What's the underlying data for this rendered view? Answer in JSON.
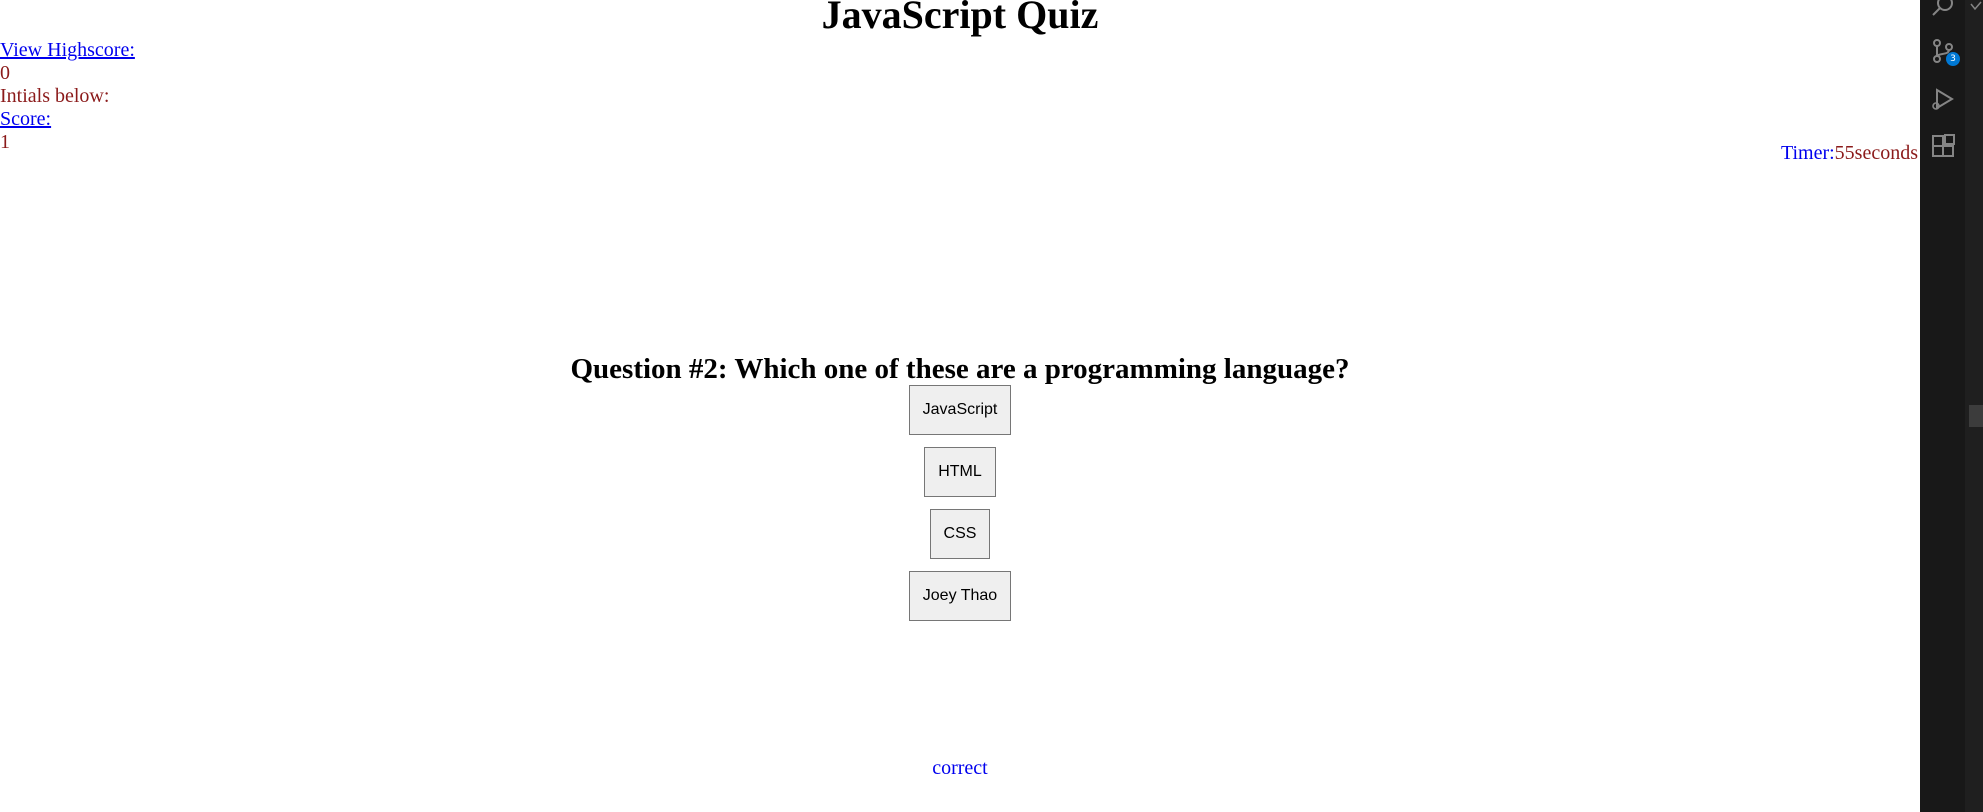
{
  "title": "JavaScript Quiz",
  "left_info": {
    "view_highscore": "View Highscore:",
    "highscore_value": "0",
    "initials_label": "Intials below:",
    "score_label": "Score:",
    "score_value": "1"
  },
  "timer": {
    "label": "Timer:",
    "value": "55seconds"
  },
  "question": "Question #2: Which one of these are a programming language?",
  "answers": [
    "JavaScript",
    "HTML",
    "CSS",
    "Joey Thao"
  ],
  "feedback": "correct",
  "sidebar": {
    "icons": [
      "search-icon",
      "source-control-icon",
      "run-debug-icon",
      "extensions-icon"
    ],
    "source_control_badge": "3"
  },
  "colors": {
    "link": "#0000ee",
    "value_text": "#8b1a1a",
    "activity_bar": "#181818",
    "badge": "#0078d4"
  }
}
